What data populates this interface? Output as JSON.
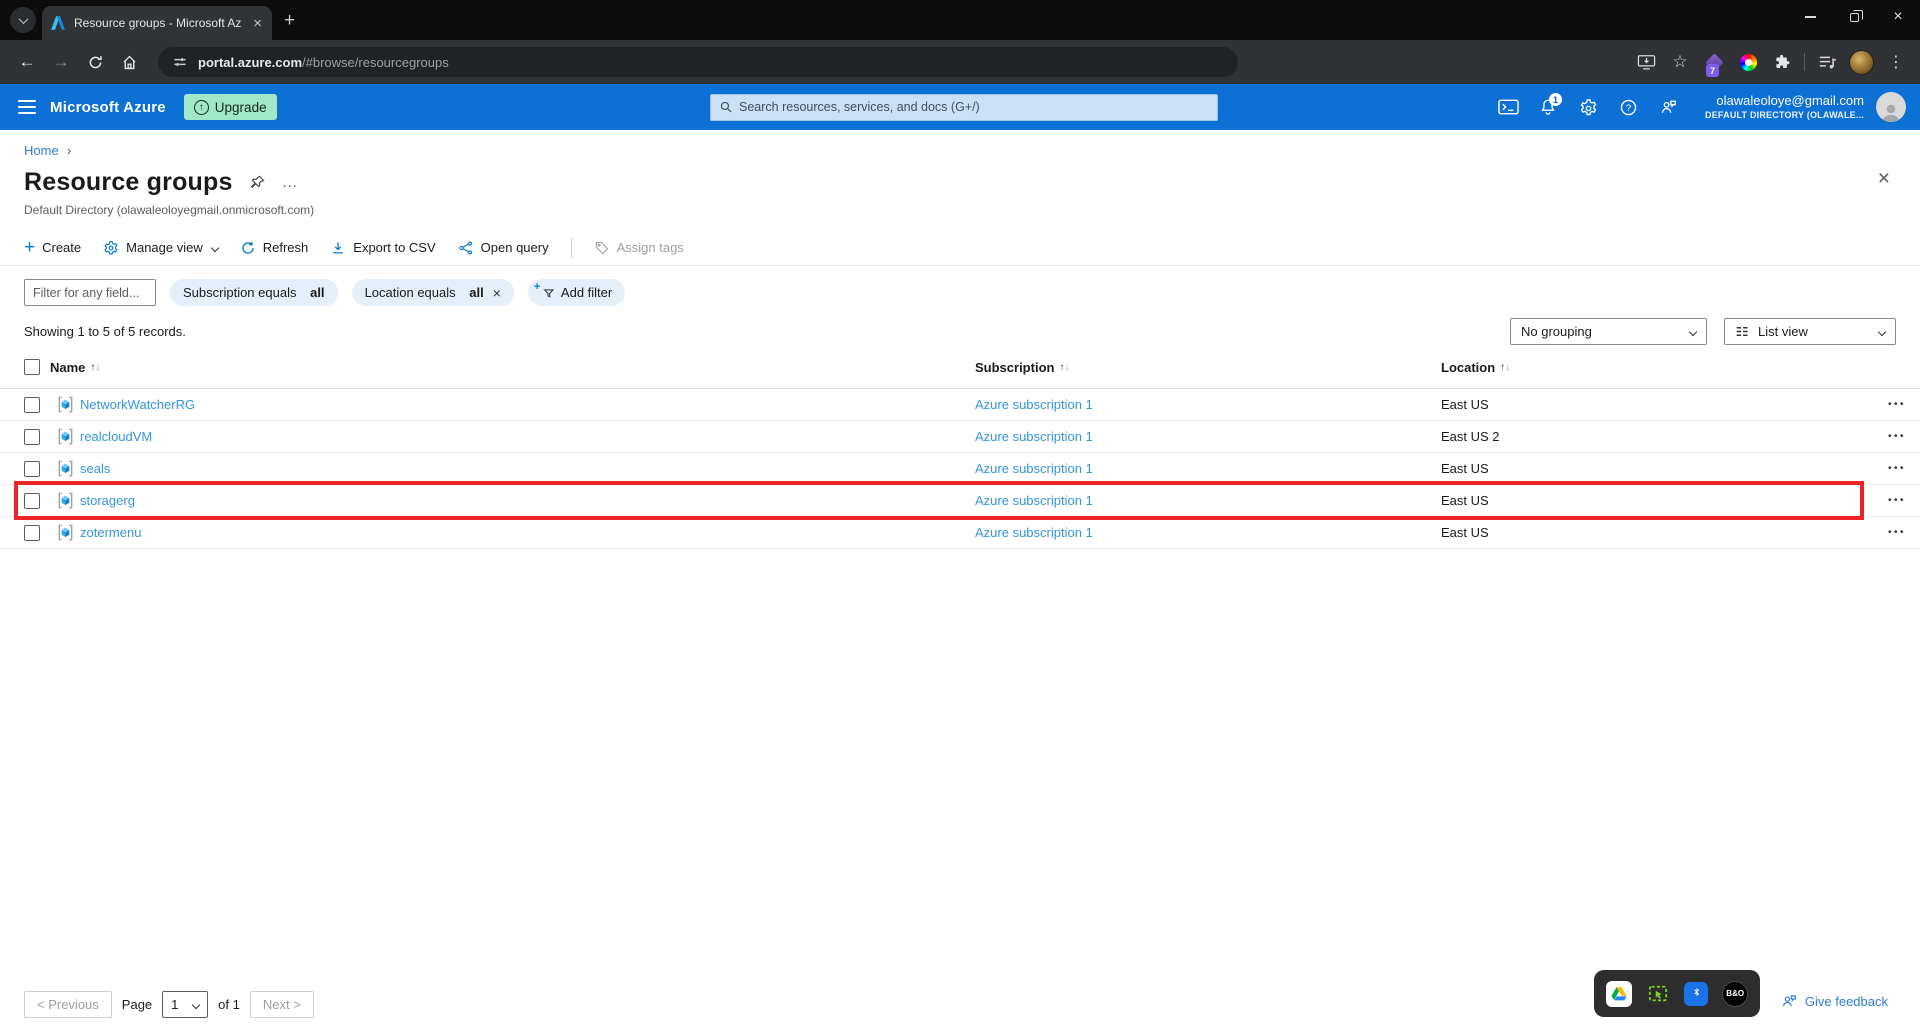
{
  "colors": {
    "azure_blue": "#0c70d4",
    "command_blue": "#0078d4",
    "link_blue": "#3395dc",
    "highlight_red": "#ee2424",
    "upgrade_green": "#9fe7c6"
  },
  "browser": {
    "tab_title": "Resource groups - Microsoft Az",
    "url_host": "portal.azure.com",
    "url_path": "/#browse/resourcegroups",
    "extension_badge": "7"
  },
  "glyphs": {
    "back": "←",
    "forward": "→",
    "star": "☆",
    "kebab": "⋮",
    "new_tab": "+",
    "tab_close": "×",
    "window_close": "×",
    "panel_close": "×",
    "breadcrumb_sep": "›",
    "title_ellipsis": "…",
    "create_plus": "+",
    "sort_up": "↑",
    "sort_down": "↓",
    "row_actions": "•••",
    "question_mark": "?",
    "upgrade_arrow": "↑",
    "pill_close": "×",
    "add_filter_plus": "+"
  },
  "topbar": {
    "brand": "Microsoft Azure",
    "upgrade": "Upgrade",
    "search_placeholder": "Search resources, services, and docs (G+/)",
    "notification_count": "1",
    "email": "olawaleoloye@gmail.com",
    "directory": "DEFAULT DIRECTORY (OLAWALE..."
  },
  "page": {
    "breadcrumb_home": "Home",
    "title": "Resource groups",
    "subtitle": "Default Directory (olawaleoloyegmail.onmicrosoft.com)",
    "toolbar": {
      "create": "Create",
      "manage_view": "Manage view",
      "refresh": "Refresh",
      "export_csv": "Export to CSV",
      "open_query": "Open query",
      "assign_tags": "Assign tags"
    },
    "filter_placeholder": "Filter for any field...",
    "pill_subscription_text": "Subscription equals",
    "pill_subscription_value": "all",
    "pill_location_text": "Location equals",
    "pill_location_value": "all",
    "add_filter": "Add filter",
    "status": "Showing 1 to 5 of 5 records.",
    "grouping_value": "No grouping",
    "view_value": "List view",
    "table": {
      "col_name": "Name",
      "col_subscription": "Subscription",
      "col_location": "Location",
      "rows": [
        {
          "name": "NetworkWatcherRG",
          "subscription": "Azure subscription 1",
          "location": "East US",
          "highlighted": false
        },
        {
          "name": "realcloudVM",
          "subscription": "Azure subscription 1",
          "location": "East US 2",
          "highlighted": false
        },
        {
          "name": "seals",
          "subscription": "Azure subscription 1",
          "location": "East US",
          "highlighted": false
        },
        {
          "name": "storagerg",
          "subscription": "Azure subscription 1",
          "location": "East US",
          "highlighted": true
        },
        {
          "name": "zotermenu",
          "subscription": "Azure subscription 1",
          "location": "East US",
          "highlighted": false
        }
      ]
    },
    "pagination": {
      "previous": "< Previous",
      "page_label": "Page",
      "current": "1",
      "of_label": "of 1",
      "next": "Next >"
    },
    "give_feedback": "Give feedback"
  },
  "tray": {
    "bo_label": "B&O"
  }
}
